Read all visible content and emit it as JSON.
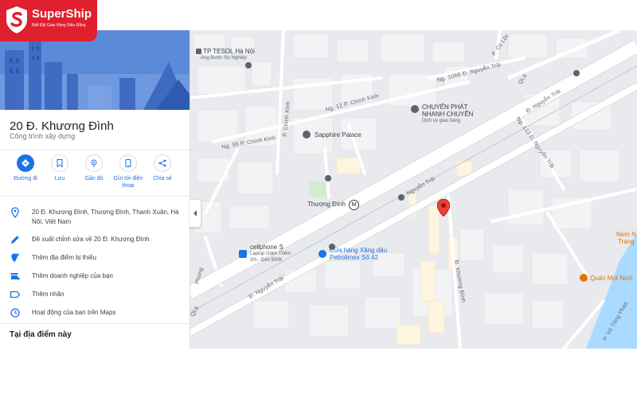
{
  "logo": {
    "brand": "SuperShip",
    "tagline": "Biệt Đội Giao Hàng Siêu Đẳng",
    "color": "#e0202e"
  },
  "place": {
    "title": "20 Đ. Khương Đình",
    "category": "Công trình xây dựng"
  },
  "actions": [
    {
      "label": "Đường đi",
      "icon": "directions-icon"
    },
    {
      "label": "Lưu",
      "icon": "bookmark-icon"
    },
    {
      "label": "Gần đó",
      "icon": "nearby-icon"
    },
    {
      "label": "Gửi tới điện thoại",
      "icon": "phone-icon"
    },
    {
      "label": "Chia sẻ",
      "icon": "share-icon"
    }
  ],
  "details": [
    {
      "icon": "location-pin-icon",
      "text": "20 Đ. Khương Đình, Thượng Đình, Thanh Xuân, Hà Nội, Việt Nam"
    },
    {
      "icon": "pencil-icon",
      "text": "Đề xuất chỉnh sửa về 20 Đ. Khương Đình"
    },
    {
      "icon": "add-place-icon",
      "text": "Thêm địa điểm bị thiếu"
    },
    {
      "icon": "add-business-icon",
      "text": "Thêm doanh nghiệp của bạn"
    },
    {
      "icon": "label-icon",
      "text": "Thêm nhãn"
    },
    {
      "icon": "history-icon",
      "text": "Hoạt động của bạn trên Maps"
    }
  ],
  "nearby_heading": "Tại địa điểm này",
  "map": {
    "streets": {
      "nguyen_trai_1": "Đ. Nguyễn Trãi",
      "nguyen_trai_2": "Đ. Nguyễn Trãi",
      "nguyen_trai_3": "Đ. Nguyễn Trãi",
      "khuong_dinh": "Đ. Khương Đình",
      "chinh_kinh": "P. Chính Kinh",
      "ng12_chinh_kinh": "Ng. 12 P. Chính Kinh",
      "ng55_chinh_kinh": "Ng. 55 P. Chính Kinh",
      "ng108_nguyen_trai": "Ng. 108B Đ. Nguyễn Trãi",
      "ng133_nguyen_trai": "Ng. 133 Đ. Nguyễn Trãi",
      "cu_loc": "P. Cù Lộc",
      "ql6_top": "QL6",
      "ql6_bottom": "QL6",
      "phung": "Phùng",
      "vu_tong_phan": "P. Vũ Tông Phan"
    },
    "pois": {
      "tesol": "TP TESOL Hà Nội",
      "tesol_sub": "ững Bước Sự Nghiệp",
      "chuyen_phat": "CHUYỂN PHÁT",
      "chuyen_phat_2": "NHANH CHUYỂN",
      "chuyen_phat_sub": "Dịch vụ giao hàng",
      "sapphire": "Sapphire Palace",
      "thuong_dinh": "Thượng Đình",
      "metro_symbol": "M",
      "cellphones": "cellphone S",
      "cellphones_sub1": "Laptop Giảm Thêm",
      "cellphones_sub2": "3% - Đến 500K",
      "petrolimex": "Cửa hàng Xăng dầu",
      "petrolimex_2": "Petrolimex Số 42",
      "quan_moc": "Quán Mọt Nướ",
      "nem": "Nem N",
      "trang": "Trang"
    },
    "colors": {
      "land": "#e8eaed",
      "road": "#ffffff",
      "major_road": "#ffffff",
      "building": "#f1f3f4",
      "river": "#aadaff",
      "park": "#d4ecd4",
      "pin": "#ea4335",
      "accent": "#1a73e8"
    }
  },
  "hero": {
    "sky": "#4f7fd4",
    "sky_light": "#6f98e0"
  }
}
